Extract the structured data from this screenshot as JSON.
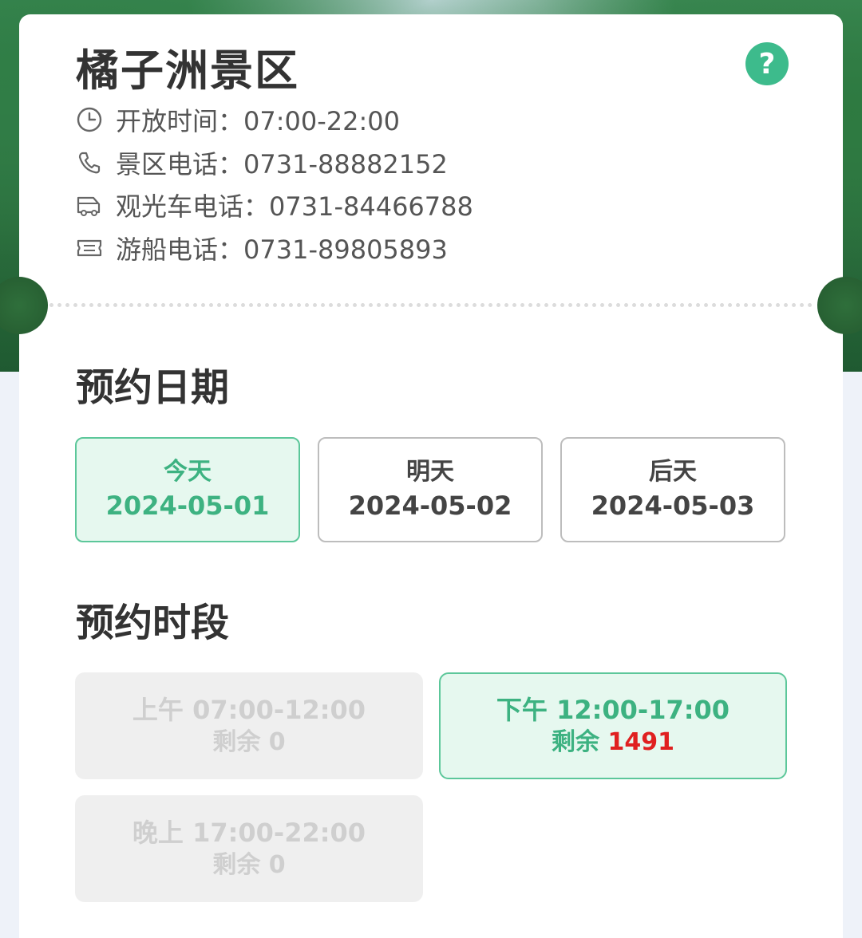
{
  "scenic": {
    "title": "橘子洲景区",
    "help_label": "?",
    "info": [
      {
        "icon": "clock-icon",
        "label": "开放时间：07:00-22:00"
      },
      {
        "icon": "phone-icon",
        "label": "景区电话：0731-88882152"
      },
      {
        "icon": "shuttle-bus-icon",
        "label": "观光车电话：0731-84466788"
      },
      {
        "icon": "ticket-icon",
        "label": "游船电话：0731-89805893"
      }
    ]
  },
  "date_section": {
    "title": "预约日期",
    "dates": [
      {
        "label": "今天",
        "date": "2024-05-01",
        "selected": true
      },
      {
        "label": "明天",
        "date": "2024-05-02",
        "selected": false
      },
      {
        "label": "后天",
        "date": "2024-05-03",
        "selected": false
      }
    ]
  },
  "time_section": {
    "title": "预约时段",
    "slots": [
      {
        "time": "上午 07:00-12:00",
        "remain_label": "剩余",
        "remain": "0",
        "state": "disabled"
      },
      {
        "time": "下午 12:00-17:00",
        "remain_label": "剩余",
        "remain": "1491",
        "state": "selected"
      },
      {
        "time": "晚上 17:00-22:00",
        "remain_label": "剩余",
        "remain": "0",
        "state": "disabled"
      }
    ]
  },
  "colors": {
    "accent": "#3db281",
    "accent_bg": "#e6f8ef",
    "remain_highlight": "#e02020",
    "disabled_bg": "#efefef"
  }
}
